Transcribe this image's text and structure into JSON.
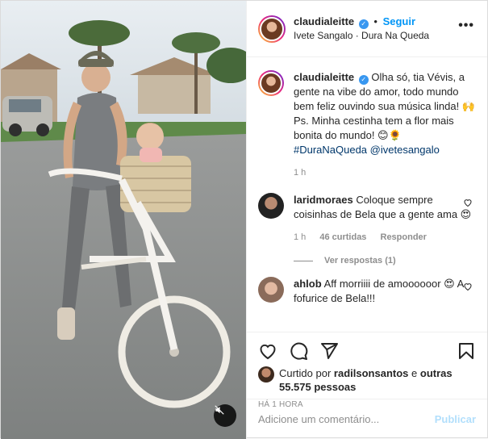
{
  "post": {
    "username": "claudialeitte",
    "verified": true,
    "separator": "•",
    "follow_label": "Seguir",
    "location": "Ivete Sangalo · Dura Na Queda",
    "more_label": "•••"
  },
  "caption": {
    "username": "claudialeitte",
    "text": "Olha só, tia Vévis, a gente na vibe do amor, todo mundo bem feliz ouvindo sua música linda! 🙌 Ps. Minha cestinha tem a flor mais bonita do mundo! 😊🌻",
    "hashtag": "#DuraNaQueda",
    "mention": "@ivetesangalo",
    "time": "1 h"
  },
  "comments": [
    {
      "username": "laridmoraes",
      "text": "Coloque sempre coisinhas de Bela que a gente ama 😍",
      "time": "1 h",
      "likes": "46 curtidas",
      "reply_label": "Responder",
      "view_replies": "Ver respostas (1)"
    },
    {
      "username": "ahlob",
      "text": "Aff morriiii de amoooooor 😍 A fofurice de Bela!!!"
    }
  ],
  "likes": {
    "prefix": "Curtido por",
    "user": "radilsonsantos",
    "conjunction": "e",
    "others": "outras 55.575 pessoas"
  },
  "timestamp": "HÁ 1 HORA",
  "add_comment": {
    "placeholder": "Adicione um comentário...",
    "publish_label": "Publicar"
  },
  "icons": [
    "heart-icon",
    "comment-icon",
    "share-icon",
    "save-icon",
    "mute-icon",
    "verified-icon"
  ]
}
